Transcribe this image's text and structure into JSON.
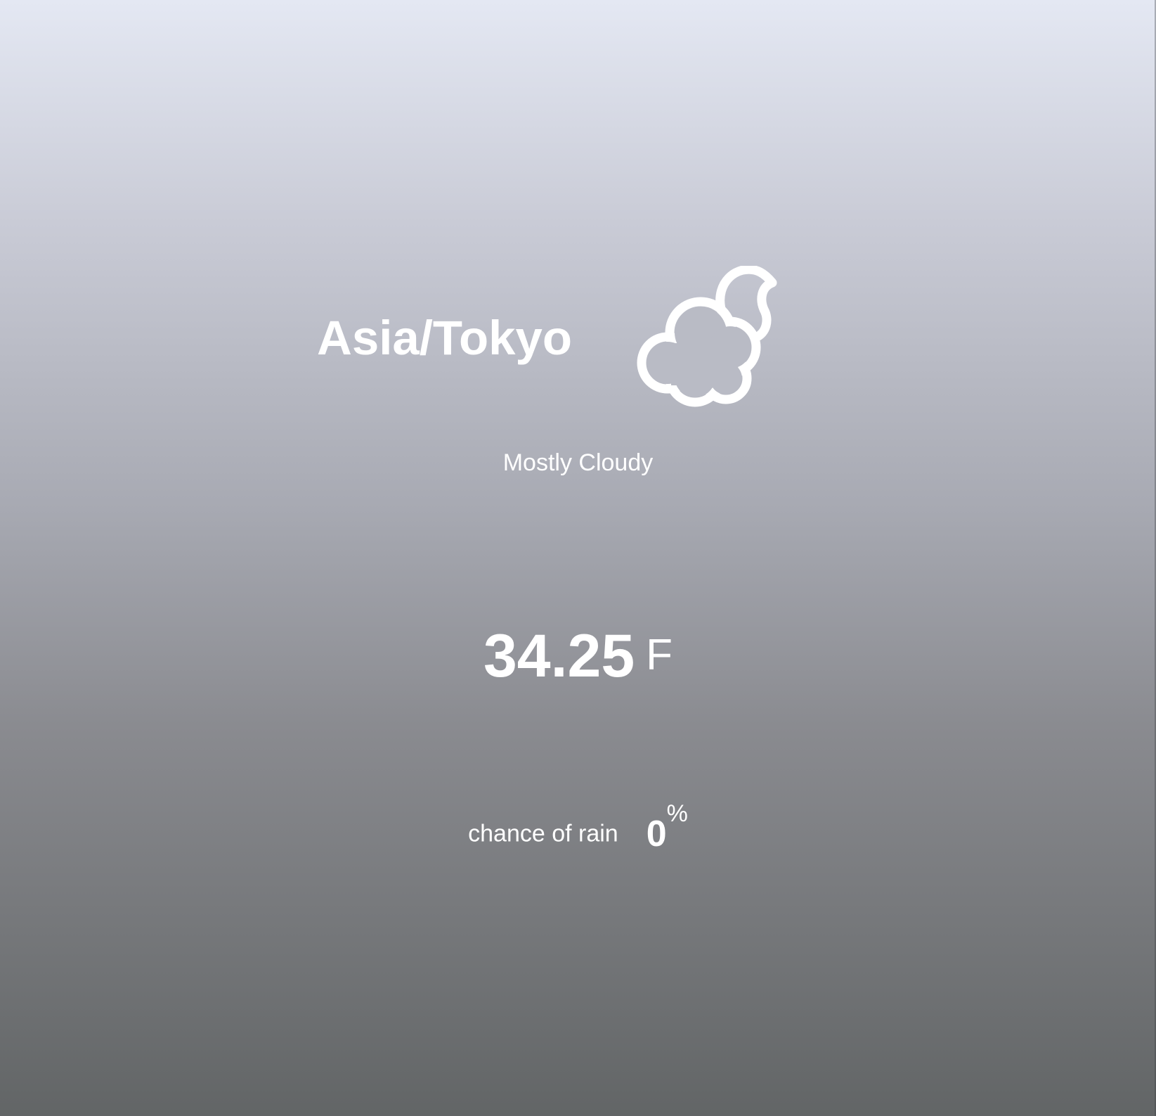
{
  "location": "Asia/Tokyo",
  "condition": {
    "text": "Mostly Cloudy",
    "icon": "cloud-moon-icon"
  },
  "temperature": {
    "value": "34.25",
    "unit": "F"
  },
  "rain": {
    "label": "chance of rain",
    "value": "0",
    "unit": "%"
  },
  "colors": {
    "text": "#ffffff",
    "background_top": "#e4e8f3",
    "background_bottom": "#626566"
  }
}
